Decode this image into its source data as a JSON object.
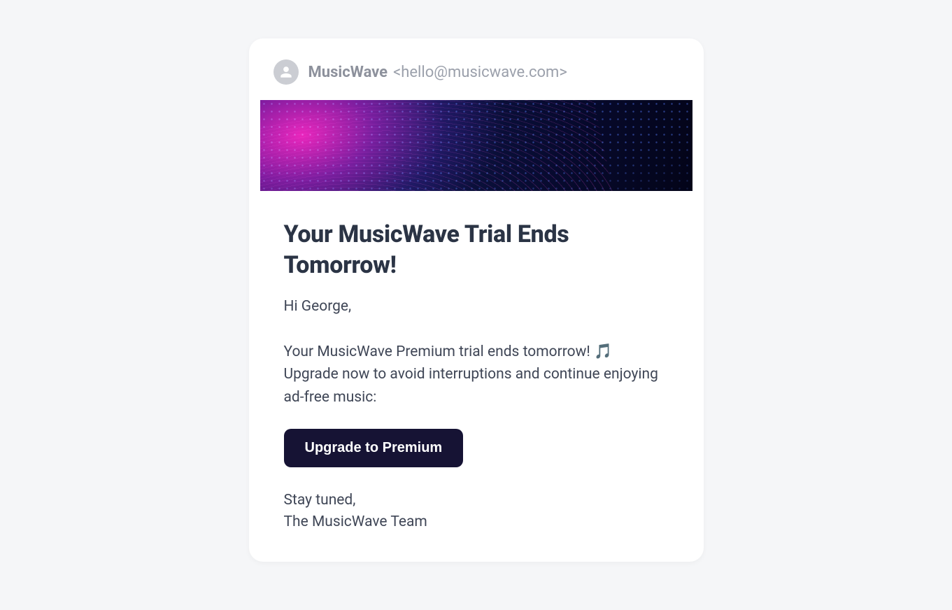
{
  "sender": {
    "name": "MusicWave",
    "email": "<hello@musicwave.com>"
  },
  "content": {
    "title": "Your MusicWave Trial Ends Tomorrow!",
    "greeting": "Hi George,",
    "body": "Your MusicWave Premium trial ends tomorrow! 🎵 Upgrade now to avoid interruptions and continue enjoying ad-free music:",
    "cta_label": "Upgrade to Premium",
    "signoff_line1": "Stay tuned,",
    "signoff_line2": "The MusicWave Team"
  }
}
